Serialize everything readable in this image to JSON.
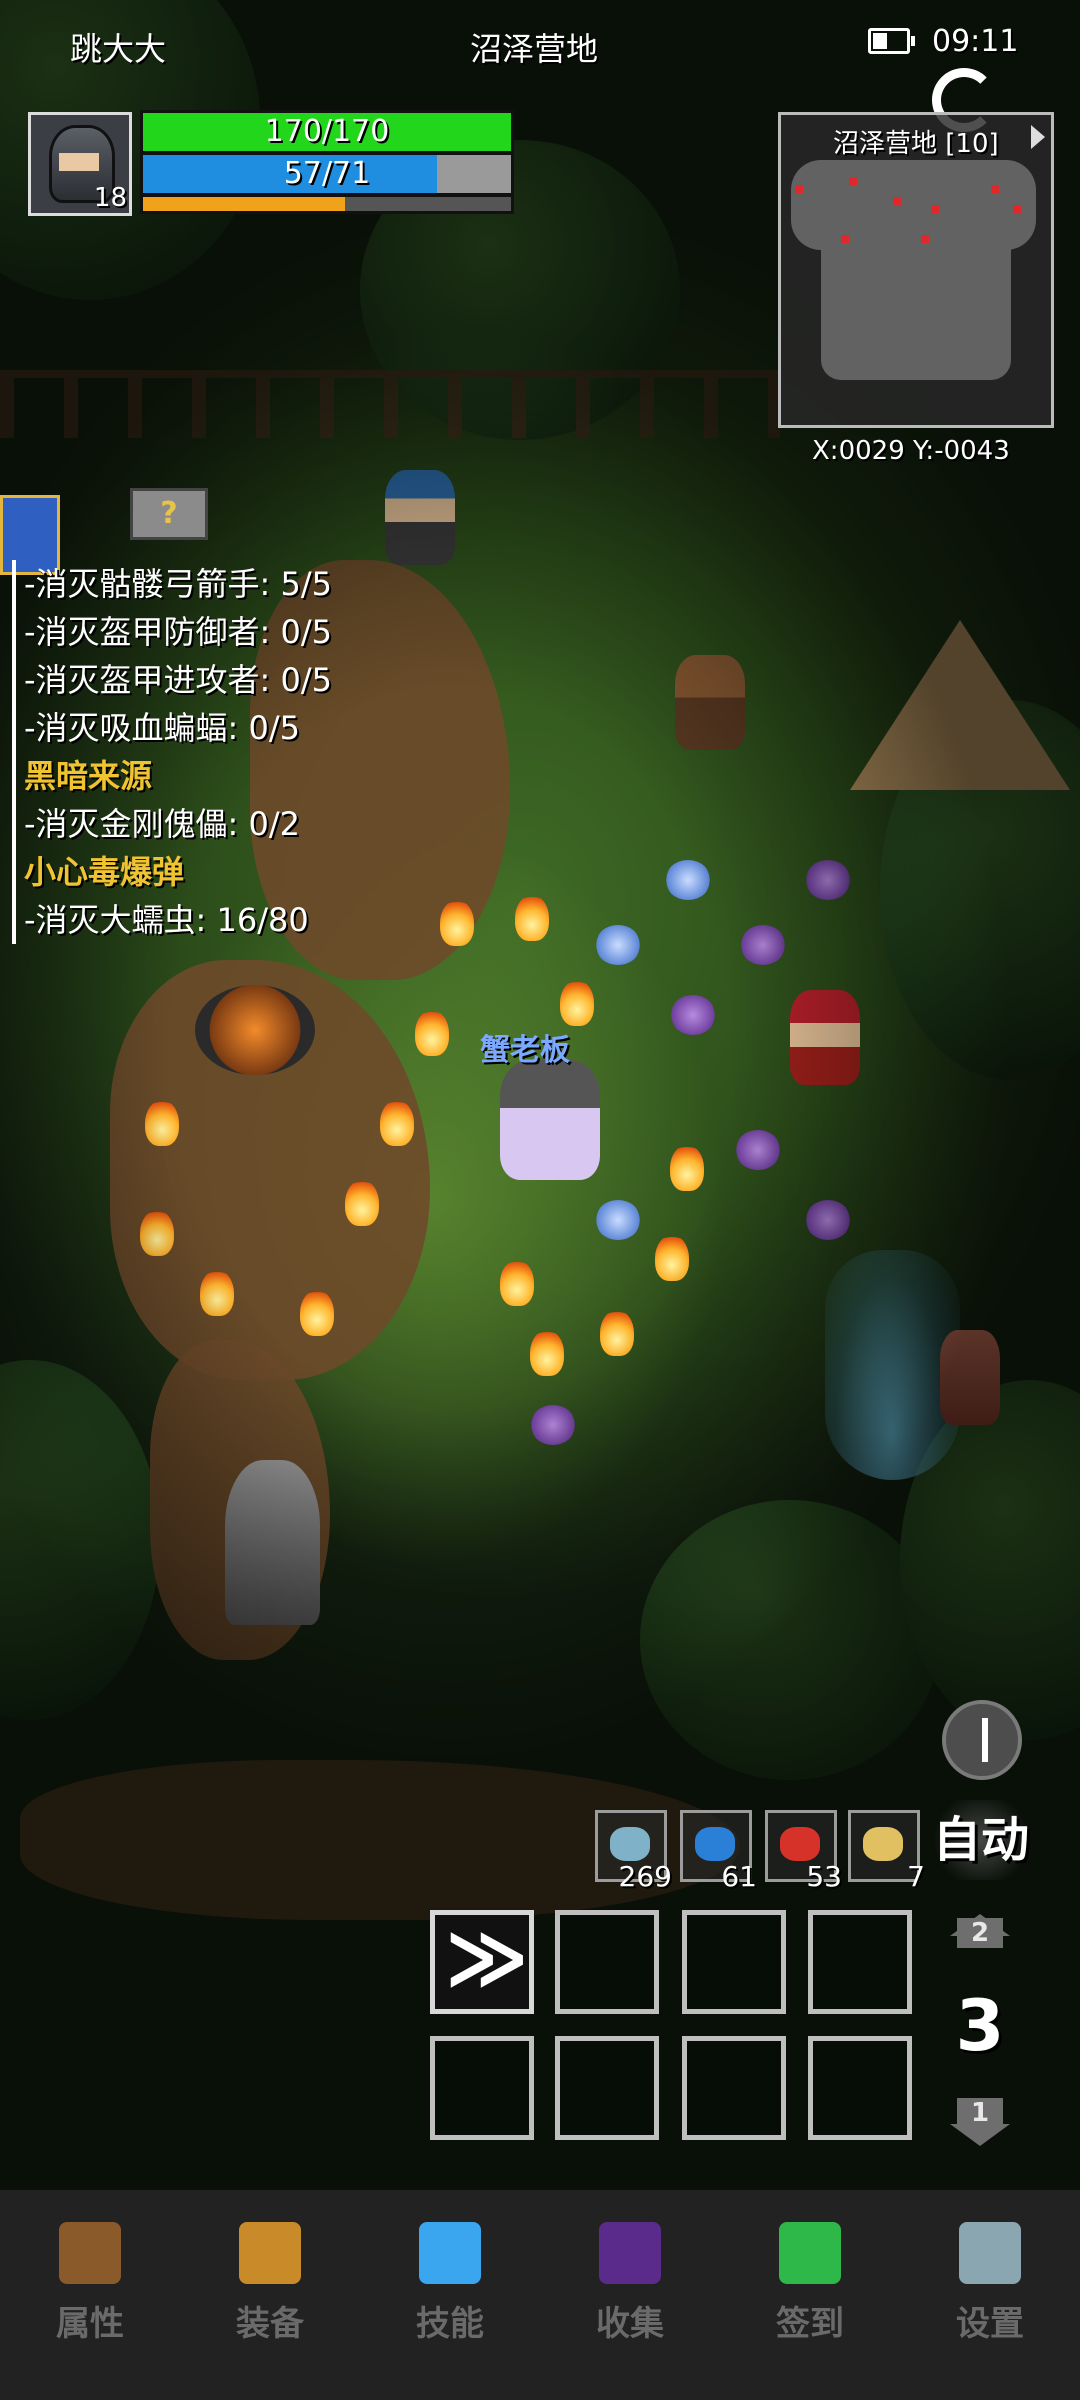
{
  "status_bar": {
    "player_name": "跳大大",
    "map_name": "沼泽营地",
    "time": "09:11"
  },
  "player": {
    "level": "18",
    "hp_text": "170/170",
    "hp_fraction": 1.0,
    "mp_text": "57/71",
    "mp_fraction": 0.8,
    "xp_fraction": 0.55
  },
  "minimap": {
    "title": "沼泽营地 [10]",
    "coords": "X:0029  Y:-0043"
  },
  "quests": [
    {
      "text": "-消灭骷髅弓箭手: 5/5",
      "type": "task"
    },
    {
      "text": "-消灭盔甲防御者: 0/5",
      "type": "task"
    },
    {
      "text": "-消灭盔甲进攻者: 0/5",
      "type": "task"
    },
    {
      "text": "-消灭吸血蝙蝠: 0/5",
      "type": "task"
    },
    {
      "text": "黑暗来源",
      "type": "head"
    },
    {
      "text": "-消灭金刚傀儡: 0/2",
      "type": "task"
    },
    {
      "text": "小心毒爆弹",
      "type": "head"
    },
    {
      "text": "-消灭大蠕虫: 16/80",
      "type": "task"
    }
  ],
  "quest_help_icon": "?",
  "npc_label": "蟹老板",
  "consumables": [
    {
      "icon": "fish-icon",
      "count": "269",
      "color": "#7fb2c9"
    },
    {
      "icon": "blue-fish-icon",
      "count": "61",
      "color": "#2a7fd6"
    },
    {
      "icon": "red-fish-icon",
      "count": "53",
      "color": "#d6322a"
    },
    {
      "icon": "scroll-icon",
      "count": "7",
      "color": "#e0c060"
    }
  ],
  "auto_label": "自动",
  "skill_page": {
    "up": "2",
    "current": "3",
    "down": "1"
  },
  "nav": [
    {
      "label": "属性",
      "icon": "helmet-icon",
      "color": "#8a5a2b"
    },
    {
      "label": "装备",
      "icon": "pot-icon",
      "color": "#c98b2a"
    },
    {
      "label": "技能",
      "icon": "crystal-icon",
      "color": "#3aa6f0"
    },
    {
      "label": "收集",
      "icon": "book-icon",
      "color": "#5a2b8a"
    },
    {
      "label": "签到",
      "icon": "gem-icon",
      "color": "#2fb84a"
    },
    {
      "label": "设置",
      "icon": "gear-icon",
      "color": "#8aa6b0"
    }
  ]
}
